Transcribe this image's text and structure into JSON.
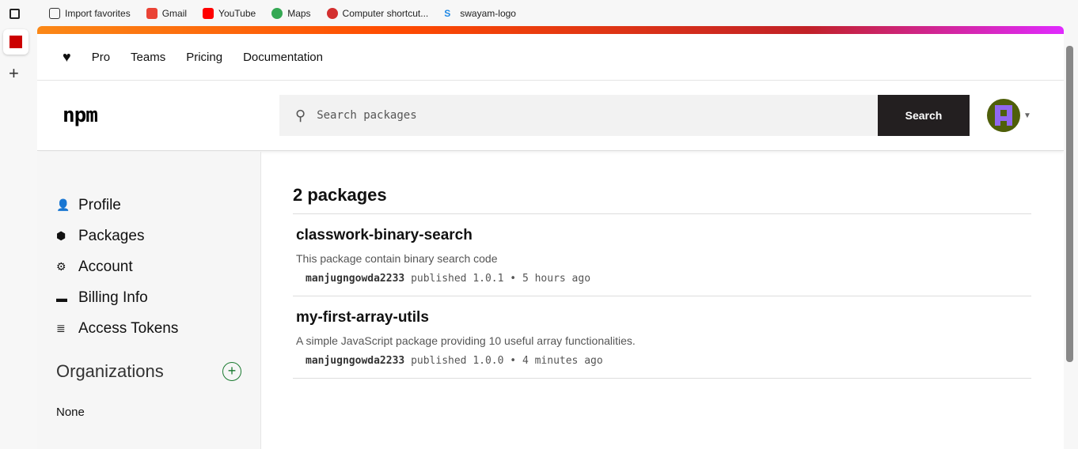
{
  "favorites": [
    "Import favorites",
    "Gmail",
    "YouTube",
    "Maps",
    "Computer shortcut...",
    "swayam-logo"
  ],
  "topnav": [
    "Pro",
    "Teams",
    "Pricing",
    "Documentation"
  ],
  "logo": "npm",
  "search": {
    "placeholder": "Search packages",
    "button": "Search"
  },
  "sidebar": {
    "items": [
      "Profile",
      "Packages",
      "Account",
      "Billing Info",
      "Access Tokens"
    ],
    "org_title": "Organizations",
    "org_value": "None"
  },
  "main": {
    "count": "2 packages",
    "packages": [
      {
        "name": "classwork-binary-search",
        "desc": "This package contain binary search code",
        "author": "manjugngowda2233",
        "pub": "published 1.0.1 • 5 hours ago"
      },
      {
        "name": "my-first-array-utils",
        "desc": "A simple JavaScript package providing 10 useful array functionalities.",
        "author": "manjugngowda2233",
        "pub": "published 1.0.0 • 4 minutes ago"
      }
    ]
  }
}
